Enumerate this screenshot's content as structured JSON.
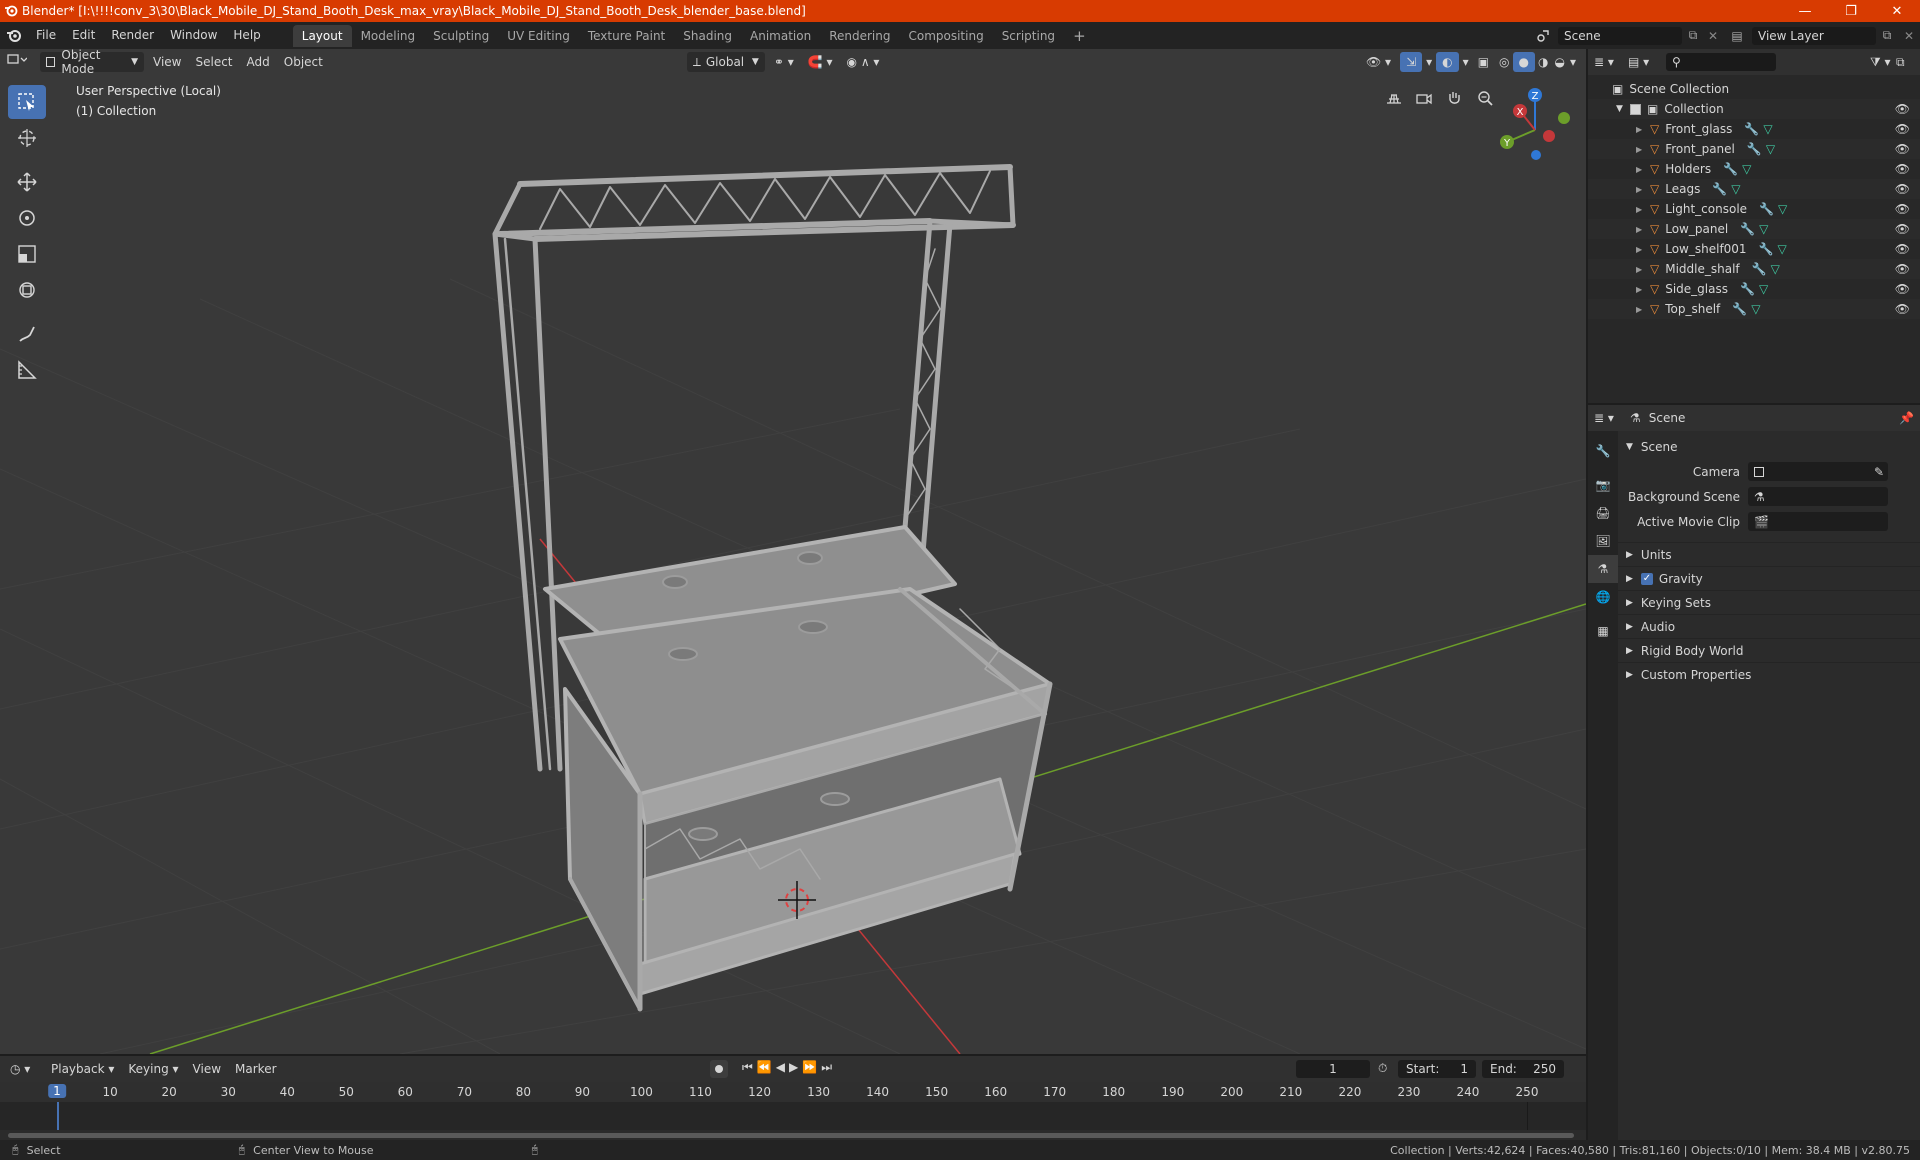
{
  "titlebar": {
    "title": "Blender* [I:\\!!!!conv_3\\30\\Black_Mobile_DJ_Stand_Booth_Desk_max_vray\\Black_Mobile_DJ_Stand_Booth_Desk_blender_base.blend]",
    "minimize": "—",
    "maximize": "❐",
    "close": "✕",
    "accent": "#d83b01"
  },
  "menubar": {
    "items": [
      "File",
      "Edit",
      "Render",
      "Window",
      "Help"
    ]
  },
  "workspaces": {
    "tabs": [
      "Layout",
      "Modeling",
      "Sculpting",
      "UV Editing",
      "Texture Paint",
      "Shading",
      "Animation",
      "Rendering",
      "Compositing",
      "Scripting"
    ],
    "add": "+"
  },
  "scene_selector": {
    "value": "Scene"
  },
  "viewlayer_selector": {
    "value": "View Layer"
  },
  "viewport": {
    "mode": "Object Mode",
    "menus": [
      "View",
      "Select",
      "Add",
      "Object"
    ],
    "orientation": "Global",
    "info_line1": "User Perspective (Local)",
    "info_line2": "(1) Collection",
    "gizmo": {
      "x": "X",
      "y": "Y",
      "z": "Z"
    },
    "colors": {
      "x_axis": "#c4383a",
      "y_axis": "#6c9e2a",
      "z_axis": "#2f78d6",
      "model": "#a9a9a9",
      "background": "#393939"
    }
  },
  "outliner": {
    "search_placeholder": "",
    "root": "Scene Collection",
    "collection": "Collection",
    "objects": [
      "Front_glass",
      "Front_panel",
      "Holders",
      "Leags",
      "Light_console",
      "Low_panel",
      "Low_shelf001",
      "Middle_shalf",
      "Side_glass",
      "Top_shelf"
    ]
  },
  "properties": {
    "header": "Scene",
    "panel": "Scene",
    "camera_label": "Camera",
    "background_label": "Background Scene",
    "clip_label": "Active Movie Clip",
    "subpanels": [
      "Units",
      "Gravity",
      "Keying Sets",
      "Audio",
      "Rigid Body World",
      "Custom Properties"
    ]
  },
  "timeline": {
    "menus": [
      "Playback",
      "Keying",
      "View",
      "Marker"
    ],
    "current_frame": "1",
    "start_label": "Start:",
    "start_value": "1",
    "end_label": "End:",
    "end_value": "250",
    "ticks": [
      "1",
      "10",
      "20",
      "30",
      "40",
      "50",
      "60",
      "70",
      "80",
      "90",
      "100",
      "110",
      "120",
      "130",
      "140",
      "150",
      "160",
      "170",
      "180",
      "190",
      "200",
      "210",
      "220",
      "230",
      "240",
      "250"
    ]
  },
  "statusbar": {
    "select": "Select",
    "center": "Center View to Mouse",
    "stats": "Collection | Verts:42,624 | Faces:40,580 | Tris:81,160 | Objects:0/10 | Mem: 38.4 MB | v2.80.75"
  }
}
